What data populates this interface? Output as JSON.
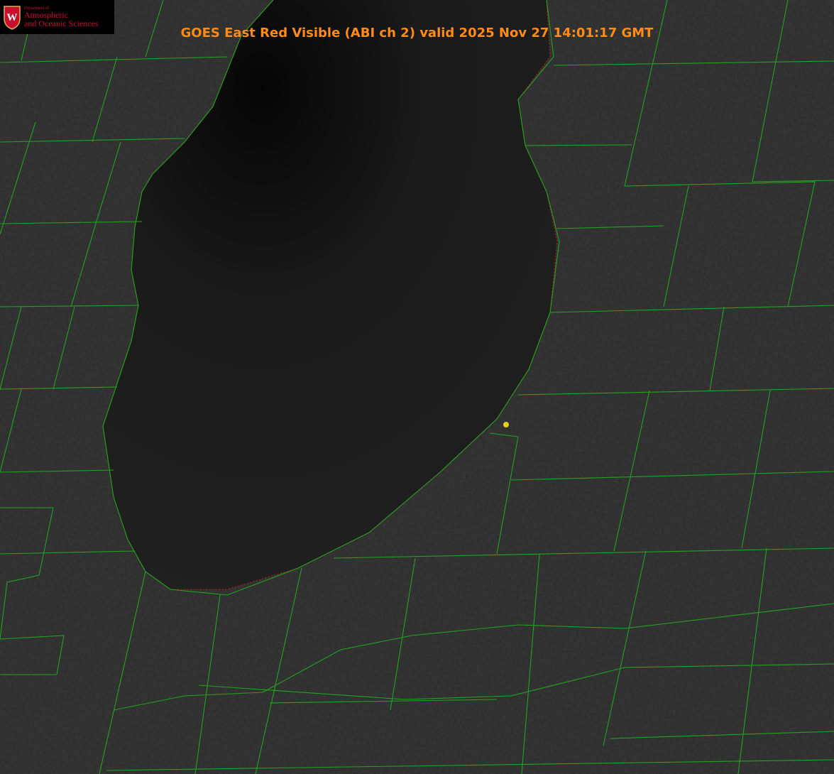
{
  "title": "GOES East Red Visible (ABI ch 2) valid 2025 Nov 27 14:01:17 GMT",
  "logo": {
    "department": "Department of",
    "line1": "Atmospheric",
    "line2": "and Oceanic Sciences",
    "emblem": "W"
  },
  "colors": {
    "title": "#ff8c1a",
    "county_lines": "#1fa51f",
    "coastline_dots": "#d01818",
    "marker": "#e0d020",
    "logo_text": "#c8102e"
  }
}
